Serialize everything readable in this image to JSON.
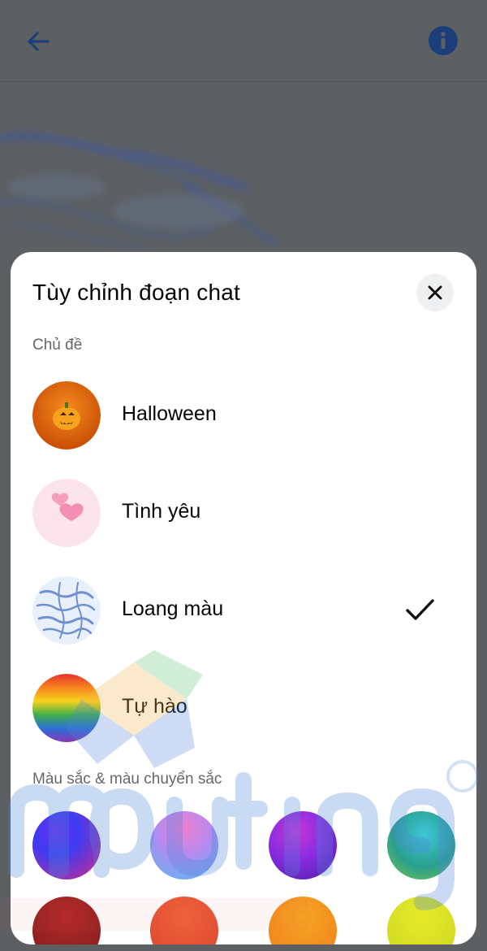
{
  "sheet": {
    "title": "Tùy chỉnh đoạn chat",
    "themes_section_label": "Chủ đề",
    "colors_section_label": "Màu sắc & màu chuyển sắc"
  },
  "themes": [
    {
      "name": "Halloween",
      "icon": "pumpkin-icon",
      "selected": false
    },
    {
      "name": "Tình yêu",
      "icon": "hearts-icon",
      "selected": false
    },
    {
      "name": "Loang màu",
      "icon": "tie-dye-icon",
      "selected": true
    },
    {
      "name": "Tự hào",
      "icon": "rainbow-icon",
      "selected": false
    }
  ],
  "colors": {
    "accent": "#1c4fa3",
    "background_overlay": "#5c6063",
    "sheet_background": "#ffffff",
    "section_label": "#65676b"
  },
  "gradients": [
    {
      "name": "gradient-blue-purple"
    },
    {
      "name": "gradient-pink-blue"
    },
    {
      "name": "gradient-purple-magenta"
    },
    {
      "name": "gradient-teal-green"
    },
    {
      "name": "gradient-crimson"
    },
    {
      "name": "gradient-orange-red"
    },
    {
      "name": "gradient-orange-yellow"
    },
    {
      "name": "gradient-lime-yellow"
    }
  ]
}
